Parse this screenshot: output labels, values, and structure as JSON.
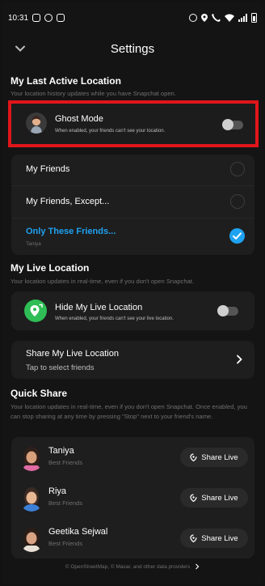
{
  "status_bar": {
    "time": "10:31",
    "left_icons": [
      "instagram-icon",
      "whatsapp-icon",
      "instagram-icon"
    ],
    "right_icons": [
      "alarm-icon",
      "location-icon",
      "wifi-call-icon",
      "wifi-icon",
      "signal-icon",
      "battery-icon"
    ]
  },
  "header": {
    "title": "Settings"
  },
  "last_active": {
    "title": "My Last Active Location",
    "subtitle": "Your location history updates while you have Snapchat open.",
    "ghost_mode": {
      "title": "Ghost Mode",
      "description": "When enabled, your friends can't see your location.",
      "enabled": false
    },
    "options": [
      {
        "label": "My Friends",
        "selected": false
      },
      {
        "label": "My Friends, Except...",
        "selected": false
      },
      {
        "label": "Only These Friends...",
        "selected": true,
        "sub": "Taniya"
      }
    ]
  },
  "live_location": {
    "title": "My Live Location",
    "subtitle": "Your location updates in real-time, even if you don't open Snapchat.",
    "hide": {
      "title": "Hide My Live Location",
      "description": "When enabled, your friends can't see your live location.",
      "enabled": false
    },
    "share": {
      "title": "Share My Live Location",
      "subtitle": "Tap to select friends"
    }
  },
  "quick_share": {
    "title": "Quick Share",
    "subtitle": "Your location updates in real-time, even if you don't open Snapchat. Once enabled, you can stop sharing at any time by pressing \"Stop\" next to your friend's name.",
    "button_label": "Share Live",
    "friends": [
      {
        "name": "Taniya",
        "relation": "Best Friends"
      },
      {
        "name": "Riya",
        "relation": "Best Friends"
      },
      {
        "name": "Geetika Sejwal",
        "relation": "Best Friends"
      }
    ]
  },
  "footer": {
    "text": "© OpenStreetMap, © Maxar, and other data providers"
  },
  "colors": {
    "accent": "#1ea2f2",
    "highlight": "#e0151b",
    "live_green": "#2fbd55"
  }
}
